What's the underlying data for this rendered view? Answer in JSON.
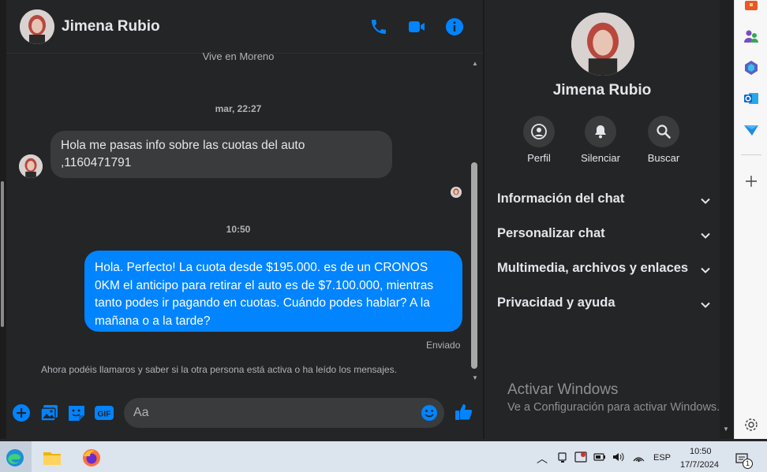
{
  "chat_header": {
    "name": "Jimena Rubio"
  },
  "conversation": {
    "status_line": "Vive en Moreno",
    "timestamp_1": "mar, 22:27",
    "incoming_line1": "Hola me pasas info sobre las cuotas del auto",
    "incoming_line2": ",1160471791",
    "timestamp_2": "10:50",
    "outgoing_line1": "Hola. Perfecto! La cuota desde $195.000. es de un CRONOS",
    "outgoing_line2": "0KM el anticipo para retirar el auto es de $7.100.000, mientras",
    "outgoing_line3": "tanto podes ir pagando en cuotas. Cuándo podes hablar? A la",
    "outgoing_line4": "mañana o a la tarde?",
    "sent_status": "Enviado",
    "notice": "Ahora podéis llamaros y saber si la otra persona está activa o ha leído los mensajes."
  },
  "composer": {
    "placeholder": "Aa"
  },
  "info_panel": {
    "name": "Jimena Rubio",
    "actions": [
      {
        "label": "Perfil",
        "icon": "profile-icon"
      },
      {
        "label": "Silenciar",
        "icon": "bell-icon"
      },
      {
        "label": "Buscar",
        "icon": "search-icon"
      }
    ],
    "sections": [
      "Información del chat",
      "Personalizar chat",
      "Multimedia, archivos y enlaces",
      "Privacidad y ayuda"
    ]
  },
  "watermark": {
    "line1": "Activar Windows",
    "line2": "Ve a Configuración para activar Windows."
  },
  "taskbar": {
    "language": "ESP",
    "time": "10:50",
    "date": "17/7/2024",
    "notification_count": "1"
  },
  "colors": {
    "accent": "#0084ff",
    "background": "#242526",
    "bubble_in": "#3a3b3c"
  }
}
